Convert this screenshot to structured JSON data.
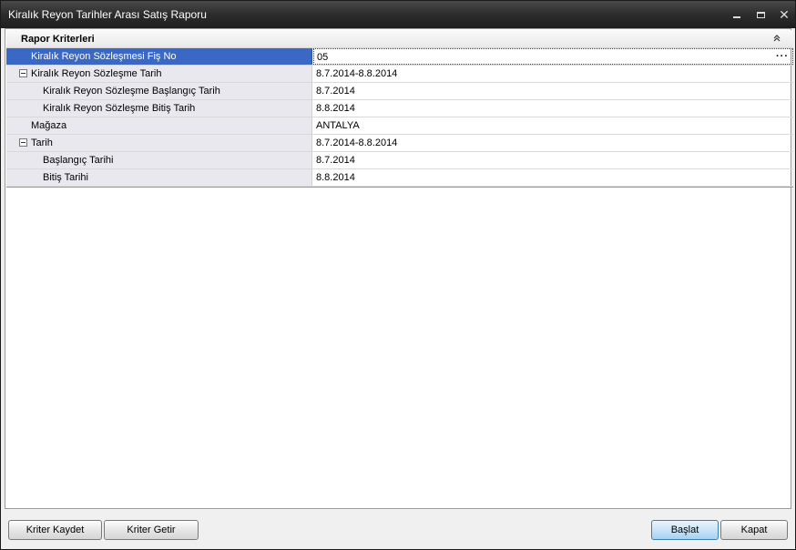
{
  "window": {
    "title": "Kiralık Reyon Tarihler Arası Satış Raporu",
    "controls": {
      "minimize": "minimize-icon",
      "maximize": "maximize-icon",
      "close": "close-icon"
    }
  },
  "criteria": {
    "category_title": "Rapor Kriterleri",
    "rows": [
      {
        "name": "Kiralık Reyon Sözleşmesi Fiş No",
        "value": "05"
      },
      {
        "name": "Kiralık Reyon Sözleşme Tarih",
        "value": "8.7.2014-8.8.2014"
      },
      {
        "name": "Kiralık Reyon Sözleşme Başlangıç Tarih",
        "value": "8.7.2014"
      },
      {
        "name": "Kiralık Reyon Sözleşme Bitiş Tarih",
        "value": "8.8.2014"
      },
      {
        "name": "Mağaza",
        "value": "ANTALYA"
      },
      {
        "name": "Tarih",
        "value": "8.7.2014-8.8.2014"
      },
      {
        "name": "Başlangıç Tarihi",
        "value": "8.7.2014"
      },
      {
        "name": "Bitiş Tarihi",
        "value": "8.8.2014"
      }
    ],
    "ellipsis": "···"
  },
  "buttons": {
    "save_criteria": "Kriter Kaydet",
    "load_criteria": "Kriter Getir",
    "start": "Başlat",
    "close": "Kapat"
  },
  "colors": {
    "selection": "#3a68c4",
    "titlebar": "#2c2c2c",
    "name_column": "#e8e8ee"
  }
}
